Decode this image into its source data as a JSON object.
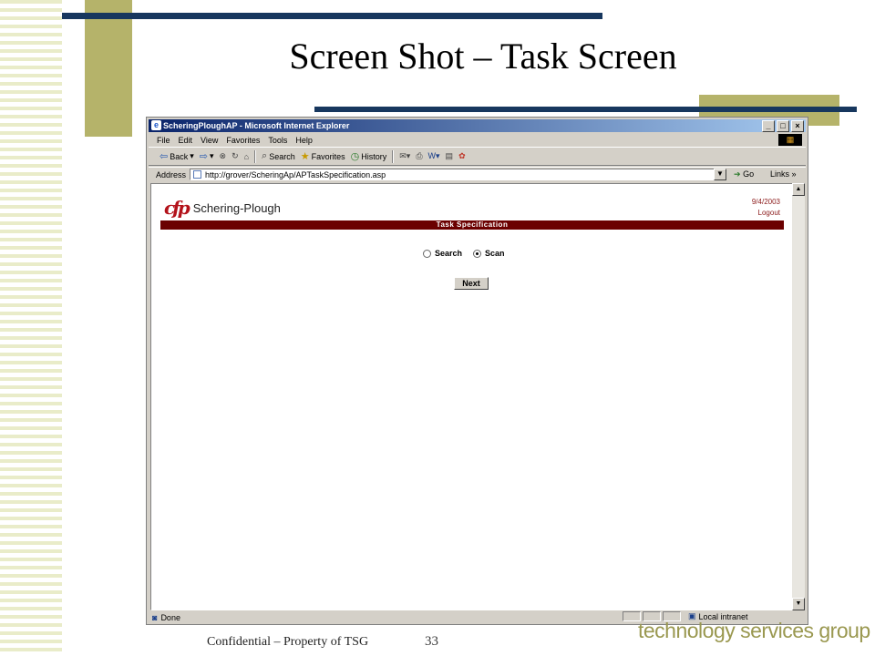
{
  "slide": {
    "title": "Screen Shot – Task Screen",
    "footer": "Confidential – Property of TSG",
    "page_number": "33",
    "brand": "technology services group",
    "colors": {
      "olive": "#b5b36a",
      "navy": "#17375e",
      "stripe": "#e9ecc9"
    }
  },
  "browser": {
    "window_title": "ScheringPloughAP - Microsoft Internet Explorer",
    "menu": [
      "File",
      "Edit",
      "View",
      "Favorites",
      "Tools",
      "Help"
    ],
    "toolbar": {
      "back": "Back",
      "search": "Search",
      "favorites": "Favorites",
      "history": "History"
    },
    "address_label": "Address",
    "url": "http://grover/ScheringAp/APTaskSpecification.asp",
    "go": "Go",
    "links": "Links",
    "status": "Done",
    "zone": "Local intranet"
  },
  "page": {
    "logo_text": "Schering-Plough",
    "date": "9/4/2003",
    "logout": "Logout",
    "header": "Task Specification",
    "options": [
      {
        "label": "Search",
        "selected": false
      },
      {
        "label": "Scan",
        "selected": true
      }
    ],
    "next": "Next",
    "accent": "#6b0000"
  }
}
